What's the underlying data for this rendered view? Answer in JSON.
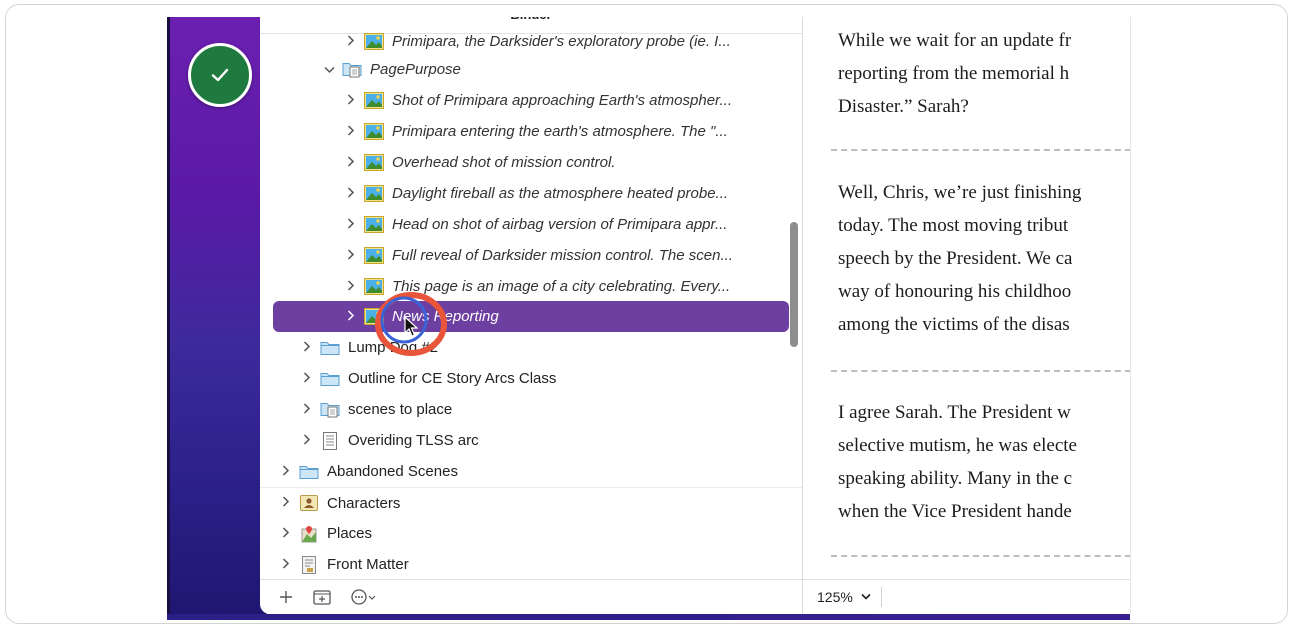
{
  "binder": {
    "title": "Binder",
    "rows": [
      {
        "label": "Primipara, the Darksider's exploratory probe (ie. I...",
        "icon": "image-icon",
        "expanded": false,
        "italic": true
      },
      {
        "label": "PagePurpose",
        "icon": "folder-doc-icon",
        "expanded": true,
        "italic": true
      },
      {
        "label": "Shot of Primipara approaching Earth's atmospher...",
        "icon": "image-icon",
        "expanded": false,
        "italic": true
      },
      {
        "label": "Primipara entering the earth's atmosphere. The \"...",
        "icon": "image-icon",
        "expanded": false,
        "italic": true
      },
      {
        "label": "Overhead shot of mission control.",
        "icon": "image-icon",
        "expanded": false,
        "italic": true
      },
      {
        "label": "Daylight fireball as the atmosphere heated probe...",
        "icon": "image-icon",
        "expanded": false,
        "italic": true
      },
      {
        "label": "Head on shot of airbag version of Primipara appr...",
        "icon": "image-icon",
        "expanded": false,
        "italic": true
      },
      {
        "label": "Full reveal of Darksider mission control. The scen...",
        "icon": "image-icon",
        "expanded": false,
        "italic": true
      },
      {
        "label": "This page is an image of a city celebrating. Every...",
        "icon": "image-icon",
        "expanded": false,
        "italic": true
      },
      {
        "label": "News Reporting",
        "icon": "image-icon",
        "expanded": false,
        "italic": true,
        "selected": true
      },
      {
        "label": "Lump Dog #2",
        "icon": "folder-icon",
        "expanded": false
      },
      {
        "label": "Outline for CE Story Arcs Class",
        "icon": "folder-icon",
        "expanded": false
      },
      {
        "label": "scenes to place",
        "icon": "folder-doc-icon",
        "expanded": false
      },
      {
        "label": "Overiding TLSS arc",
        "icon": "document-icon",
        "expanded": false
      },
      {
        "label": "Abandoned Scenes",
        "icon": "folder-icon",
        "expanded": false
      },
      {
        "label": "Characters",
        "icon": "character-icon",
        "expanded": false
      },
      {
        "label": "Places",
        "icon": "places-icon",
        "expanded": false
      },
      {
        "label": "Front Matter",
        "icon": "front-matter-icon",
        "expanded": false
      }
    ],
    "footer": {
      "add_icon": "plus-icon",
      "folder_icon": "add-folder-icon",
      "more_icon": "ellipsis-circle-icon"
    }
  },
  "editor": {
    "paragraphs": [
      [
        "While we wait for an update fr",
        "reporting from the memorial h",
        "Disaster.” Sarah?"
      ],
      [
        "Well, Chris, we’re just finishing",
        "today. The most moving tribut",
        "speech by the President. We ca",
        "way of honouring his childhoo",
        "among the victims of the disas"
      ],
      [
        "I agree Sarah. The President w",
        "selective mutism, he was electe",
        "speaking ability. Many in the c",
        "when the Vice President hande"
      ]
    ],
    "zoom": "125%"
  },
  "overlay": {
    "status_icon": "checkmark-icon",
    "colors": {
      "selection": "#6c3fa0",
      "check_badge": "#1f7a3f",
      "click_outer": "#e8553a",
      "click_inner": "#3a63d8"
    }
  }
}
